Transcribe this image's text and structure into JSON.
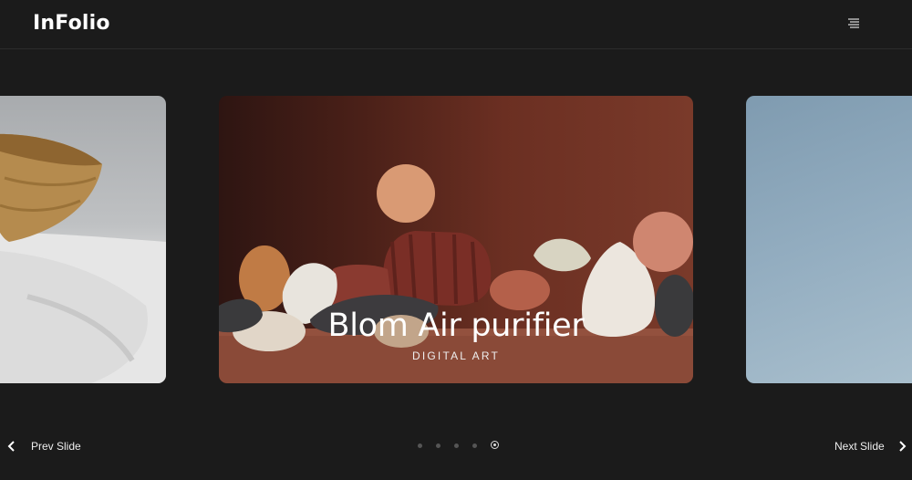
{
  "header": {
    "logo": "InFolio",
    "menu_icon": "hamburger-menu-icon"
  },
  "slider": {
    "current": {
      "title": "Blom Air purifier",
      "category": "DIGITAL ART"
    },
    "dot_count": 5,
    "active_dot": 5
  },
  "nav": {
    "prev_label": "Prev Slide",
    "next_label": "Next Slide",
    "prev_icon": "chevron-left-icon",
    "next_icon": "chevron-right-icon"
  },
  "colors": {
    "background": "#1b1b1b",
    "text": "#ffffff"
  }
}
